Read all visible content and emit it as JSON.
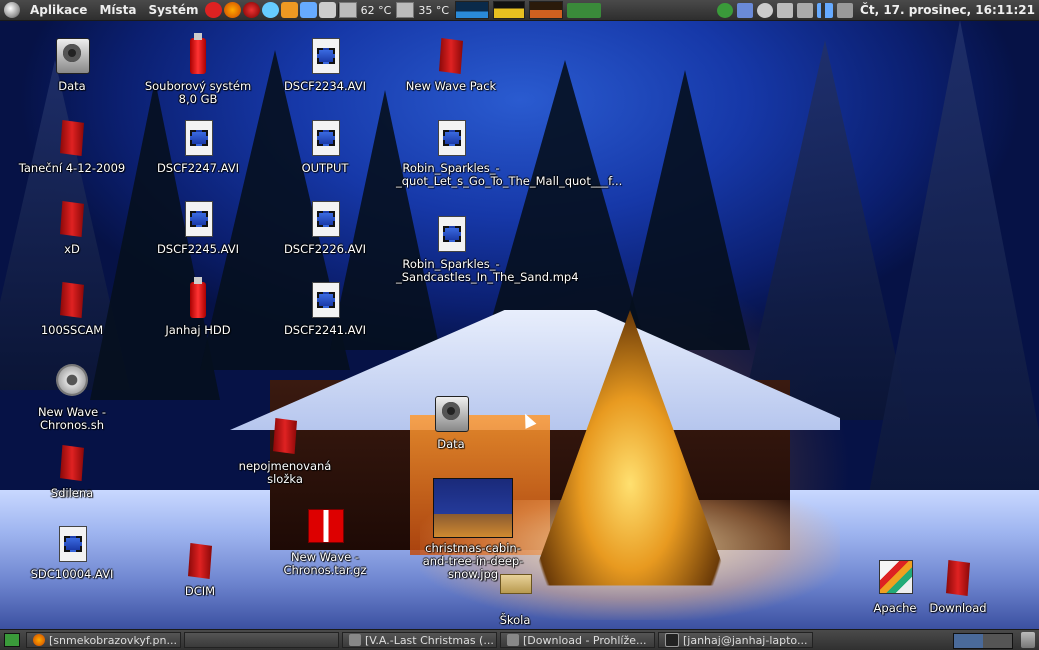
{
  "top_panel": {
    "menus": [
      "Aplikace",
      "Místa",
      "Systém"
    ],
    "cpu_temp": "62 °C",
    "hdd_temp": "35 °C",
    "clock": "Čt, 17. prosinec, 16:11:21"
  },
  "desktop_icons": {
    "data_1": "Data",
    "fs_8gb": "Souborový systém 8,0 GB",
    "dscf2234": "DSCF2234.AVI",
    "new_wave_pack": "New Wave Pack",
    "tanecni": "Taneční 4-12-2009",
    "dscf2247": "DSCF2247.AVI",
    "output": "OUTPUT",
    "robin_1": "Robin_Sparkles_-_quot_Let_s_Go_To_The_Mall_quot___f...",
    "xd": "xD",
    "dscf2245": "DSCF2245.AVI",
    "dscf2226": "DSCF2226.AVI",
    "robin_2": "Robin_Sparkles_-_Sandcastles_In_The_Sand.mp4",
    "scam": "100SSCAM",
    "janhaj_hdd": "Janhaj HDD",
    "dscf2241": "DSCF2241.AVI",
    "chronos_sh": "New Wave - Chronos.sh",
    "data_2": "Data",
    "nepojmenovana": "nepojmenovaná složka",
    "sdilena": "Sdilena",
    "christmas_jpg": "christmas-cabin-and-tree-in-deep-snow.jpg",
    "sdc10004": "SDC10004.AVI",
    "chronos_tgz": "New Wave - Chronos.tar.gz",
    "dcim": "DCIM",
    "skola": "Škola",
    "apache": "Apache",
    "download": "Download"
  },
  "taskbar": {
    "tasks": [
      "[snmekobrazovkyf.pn...",
      "",
      "[V.A.-Last Christmas (...",
      "[Download - Prohlíže...",
      "[janhaj@janhaj-lapto..."
    ]
  }
}
